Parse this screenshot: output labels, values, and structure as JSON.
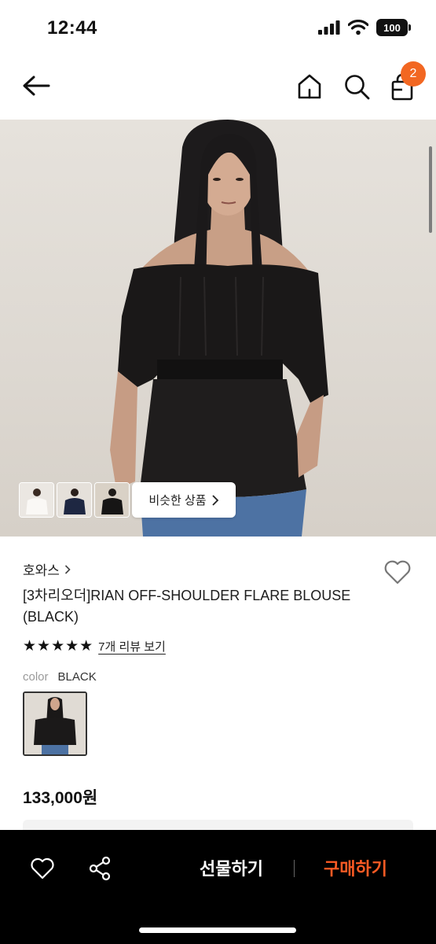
{
  "status_bar": {
    "time": "12:44",
    "battery": "100"
  },
  "nav": {
    "cart_count": "2"
  },
  "hero": {
    "similar_label": "비슷한 상품",
    "thumbnails": [
      "white-blouse",
      "navy-blouse",
      "black-blouse"
    ]
  },
  "product": {
    "brand": "호와스",
    "title": "[3차리오더]RIAN OFF-SHOULDER FLARE BLOUSE (BLACK)",
    "stars": "★★★★★",
    "rating": 5,
    "review_link": "7개 리뷰 보기",
    "color_label": "color",
    "color_value": "BLACK",
    "price": "133,000원"
  },
  "bottom_bar": {
    "gift_label": "선물하기",
    "buy_label": "구매하기"
  },
  "colors": {
    "accent": "#f26722",
    "buy": "#ff5b24",
    "bar": "#000000"
  }
}
